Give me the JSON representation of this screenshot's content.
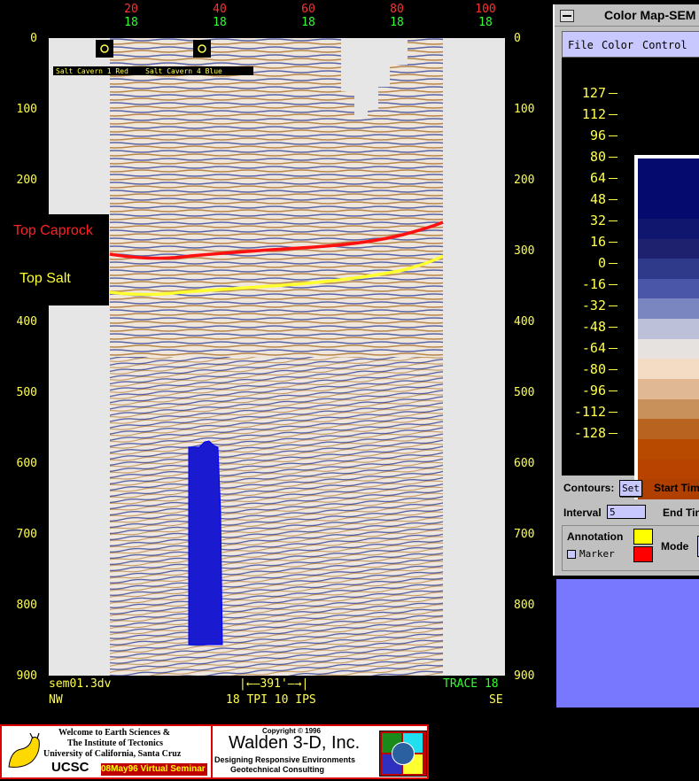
{
  "top_axis": {
    "trace_labels": [
      "20",
      "40",
      "60",
      "80",
      "100"
    ],
    "secondary_labels": [
      "18",
      "18",
      "18",
      "18",
      "18"
    ],
    "trace_color": "#ff3030",
    "secondary_color": "#30ff30"
  },
  "time_axis": {
    "ticks": [
      "0",
      "100",
      "200",
      "300",
      "400",
      "500",
      "600",
      "700",
      "800",
      "900"
    ],
    "color": "#ffff4d"
  },
  "markers": {
    "legend_text": "Salt Cavern 1 Red    Salt Cavern 4 Blue"
  },
  "horizons": {
    "top_caprock": "Top Caprock",
    "top_salt": "Top Salt",
    "caprock_color": "#ff1010",
    "salt_color": "#ffff30"
  },
  "footer": {
    "filename": "sem01.3dv",
    "direction_left": "NW",
    "scale_bar": "|←—391'—→|",
    "scale_info": "18 TPI 10 IPS",
    "trace": "TRACE 18",
    "direction_right": "SE",
    "trace_color": "#30ff30"
  },
  "color_map_window": {
    "title": "Color Map-SEM",
    "menu": [
      "File",
      "Color",
      "Control"
    ],
    "ramp_labels": [
      "127",
      "112",
      "96",
      "80",
      "64",
      "48",
      "32",
      "16",
      "0",
      "-16",
      "-32",
      "-48",
      "-64",
      "-80",
      "-96",
      "-112",
      "-128"
    ],
    "ramp_colors": [
      "#050a6e",
      "#050a6e",
      "#050a6e",
      "#10166e",
      "#1e226e",
      "#2f3a8a",
      "#4a56a8",
      "#7a86c0",
      "#bcc0d8",
      "#e6e2e0",
      "#f4dcc4",
      "#e0b894",
      "#c8905a",
      "#b86420",
      "#b84a00",
      "#b84200",
      "#b04000"
    ],
    "contours_label": "Contours:",
    "set_button": "Set",
    "start_time_label": "Start Tim",
    "interval_label": "Interval",
    "interval_value": "5",
    "end_time_label": "End Tim",
    "annotation_label": "Annotation",
    "marker_label": "Marker",
    "mode_label": "Mode",
    "annotation_color_1": "#ffff00",
    "annotation_color_2": "#ff0000"
  },
  "banner": {
    "welcome_line1": "Welcome to Earth Sciences &",
    "welcome_line2": "The Institute of Tectonics",
    "welcome_line3": "University of California, Santa Cruz",
    "ucsc": "UCSC",
    "seminar": "08May96 Virtual Seminar",
    "copyright": "Copyright © 1996",
    "company": "Walden 3-D, Inc.",
    "tagline1": "Designing Responsive Environments",
    "tagline2": "Geotechnical Consulting"
  }
}
